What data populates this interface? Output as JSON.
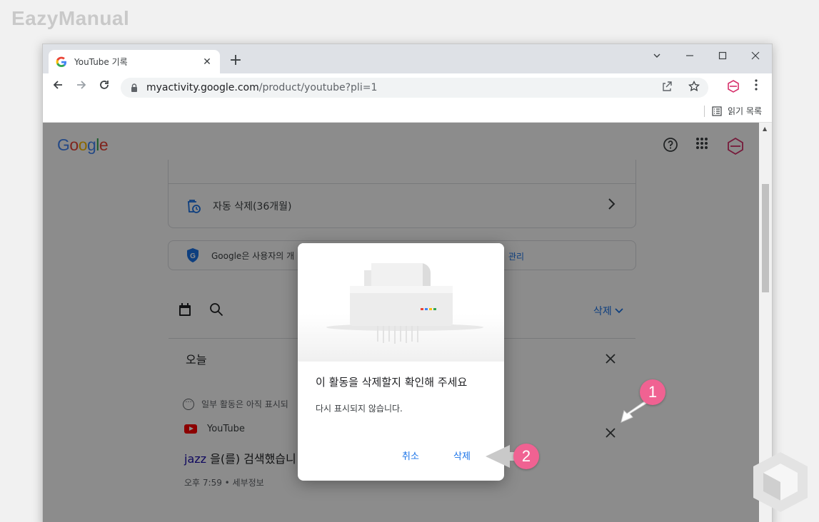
{
  "watermark": "EazyManual",
  "browser": {
    "tab_title": "YouTube 기록",
    "tab_close": "✕",
    "new_tab": "+",
    "url_host": "myactivity.google.com",
    "url_path": "/product/youtube?pli=1",
    "reading_list": "읽기 목록"
  },
  "page": {
    "logo": "Google",
    "auto_delete": "자동 삭제(36개월)",
    "privacy_notice": "Google은 사용자의 개",
    "privacy_link": "관리",
    "delete_menu": "삭제",
    "today": "오늘",
    "partial_note": "일부 활동은 아직 표시되",
    "source": "YouTube",
    "query_keyword": "jazz",
    "query_rest": " 을(를) 검색했습니",
    "time_detail": "오후 7:59 • 세부정보"
  },
  "dialog": {
    "title": "이 활동을 삭제할지 확인해 주세요",
    "body": "다시 표시되지 않습니다.",
    "cancel": "취소",
    "confirm": "삭제"
  },
  "callouts": [
    "1",
    "2"
  ],
  "colors": {
    "accent": "#1a73e8",
    "callout": "#f06292",
    "youtube_red": "#ff0000"
  }
}
